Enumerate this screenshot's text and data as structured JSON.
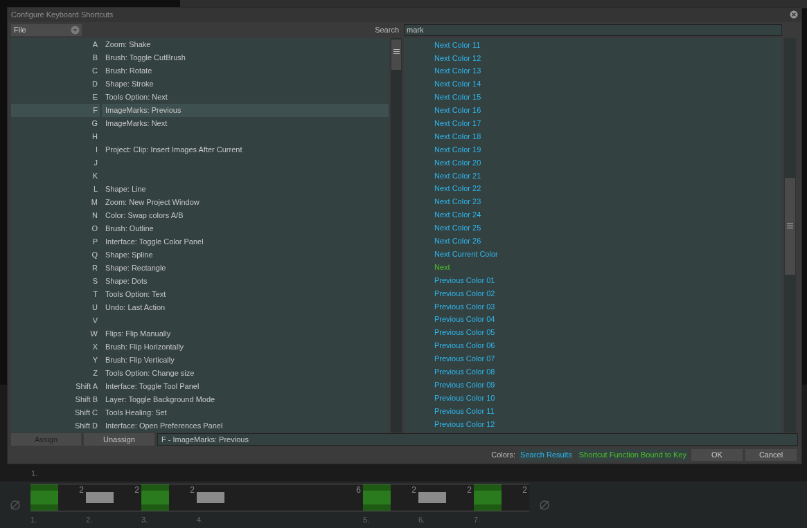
{
  "window": {
    "title": "Configure Keyboard Shortcuts"
  },
  "category": {
    "value": "File"
  },
  "search": {
    "label": "Search",
    "value": "mark"
  },
  "shortcuts": [
    {
      "key": "A",
      "function": "Zoom: Shake",
      "selected": false
    },
    {
      "key": "B",
      "function": "Brush: Toggle CutBrush",
      "selected": false
    },
    {
      "key": "C",
      "function": "Brush: Rotate",
      "selected": false
    },
    {
      "key": "D",
      "function": "Shape: Stroke",
      "selected": false
    },
    {
      "key": "E",
      "function": "Tools Option: Next",
      "selected": false
    },
    {
      "key": "F",
      "function": "ImageMarks: Previous",
      "selected": true
    },
    {
      "key": "G",
      "function": "ImageMarks: Next",
      "selected": false
    },
    {
      "key": "H",
      "selected": false
    },
    {
      "key": "I",
      "function": "Project: Clip: Insert Images After Current",
      "selected": false
    },
    {
      "key": "J",
      "selected": false
    },
    {
      "key": "K",
      "selected": false
    },
    {
      "key": "L",
      "function": "Shape: Line",
      "selected": false
    },
    {
      "key": "M",
      "function": "Zoom: New Project Window",
      "selected": false
    },
    {
      "key": "N",
      "function": "Color: Swap colors A/B",
      "selected": false
    },
    {
      "key": "O",
      "function": "Brush: Outline",
      "selected": false
    },
    {
      "key": "P",
      "function": "Interface: Toggle Color Panel",
      "selected": false
    },
    {
      "key": "Q",
      "function": "Shape: Spline",
      "selected": false
    },
    {
      "key": "R",
      "function": "Shape: Rectangle",
      "selected": false
    },
    {
      "key": "S",
      "function": "Shape: Dots",
      "selected": false
    },
    {
      "key": "T",
      "function": "Tools Option: Text",
      "selected": false
    },
    {
      "key": "U",
      "function": "Undo: Last Action",
      "selected": false
    },
    {
      "key": "V",
      "selected": false
    },
    {
      "key": "W",
      "function": "Flips: Flip Manually",
      "selected": false
    },
    {
      "key": "X",
      "function": "Brush: Flip Horizontally",
      "selected": false
    },
    {
      "key": "Y",
      "function": "Brush: Flip Vertically",
      "selected": false
    },
    {
      "key": "Z",
      "function": "Tools Option: Change size",
      "selected": false
    },
    {
      "key": "Shift A",
      "function": "Interface: Toggle Tool Panel",
      "selected": false
    },
    {
      "key": "Shift B",
      "function": "Layer: Toggle Background Mode",
      "selected": false
    },
    {
      "key": "Shift C",
      "function": "Tools Healing: Set",
      "selected": false
    },
    {
      "key": "Shift D",
      "function": "Interface: Open Preferences Panel",
      "selected": false
    }
  ],
  "functions": [
    {
      "label": "Next Color 11",
      "kind": "search_result"
    },
    {
      "label": "Next Color 12",
      "kind": "search_result"
    },
    {
      "label": "Next Color 13",
      "kind": "search_result"
    },
    {
      "label": "Next Color 14",
      "kind": "search_result"
    },
    {
      "label": "Next Color 15",
      "kind": "search_result"
    },
    {
      "label": "Next Color 16",
      "kind": "search_result"
    },
    {
      "label": "Next Color 17",
      "kind": "search_result"
    },
    {
      "label": "Next Color 18",
      "kind": "search_result"
    },
    {
      "label": "Next Color 19",
      "kind": "search_result"
    },
    {
      "label": "Next Color 20",
      "kind": "search_result"
    },
    {
      "label": "Next Color 21",
      "kind": "search_result"
    },
    {
      "label": "Next Color 22",
      "kind": "search_result"
    },
    {
      "label": "Next Color 23",
      "kind": "search_result"
    },
    {
      "label": "Next Color 24",
      "kind": "search_result"
    },
    {
      "label": "Next Color 25",
      "kind": "search_result"
    },
    {
      "label": "Next Color 26",
      "kind": "search_result"
    },
    {
      "label": "Next Current Color",
      "kind": "search_result"
    },
    {
      "label": "Next",
      "kind": "bound"
    },
    {
      "label": "Previous Color 01",
      "kind": "search_result"
    },
    {
      "label": "Previous Color 02",
      "kind": "search_result"
    },
    {
      "label": "Previous Color 03",
      "kind": "search_result"
    },
    {
      "label": "Previous Color 04",
      "kind": "search_result"
    },
    {
      "label": "Previous Color 05",
      "kind": "search_result"
    },
    {
      "label": "Previous Color 06",
      "kind": "search_result"
    },
    {
      "label": "Previous Color 07",
      "kind": "search_result"
    },
    {
      "label": "Previous Color 08",
      "kind": "search_result"
    },
    {
      "label": "Previous Color 09",
      "kind": "search_result"
    },
    {
      "label": "Previous Color 10",
      "kind": "search_result"
    },
    {
      "label": "Previous Color 11",
      "kind": "search_result"
    },
    {
      "label": "Previous Color 12",
      "kind": "search_result"
    }
  ],
  "actions": {
    "assign": "Assign",
    "unassign": "Unassign",
    "binding": "F - ImageMarks: Previous"
  },
  "legend": {
    "label": "Colors:",
    "items": [
      {
        "label": "Search Results",
        "kind": "search_result"
      },
      {
        "label": "Shortcut Function Bound to Key",
        "kind": "bound"
      }
    ]
  },
  "buttons": [
    "OK",
    "Cancel"
  ],
  "timeline": {
    "top_label": "1.",
    "frames": [
      {
        "label": "1.",
        "count": "2",
        "kind": "image"
      },
      {
        "label": "2.",
        "count": "2",
        "kind": "blank"
      },
      {
        "label": "3.",
        "count": "2",
        "kind": "image"
      },
      {
        "label": "4.",
        "count": "6",
        "kind": "blank"
      },
      {
        "label": "5.",
        "count": "2",
        "kind": "image"
      },
      {
        "label": "6.",
        "count": "2",
        "kind": "blank"
      },
      {
        "label": "7.",
        "count": "2",
        "kind": "image"
      }
    ]
  }
}
